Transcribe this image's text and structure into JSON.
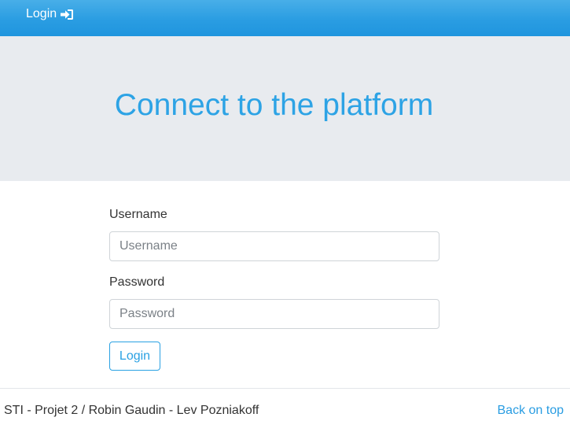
{
  "navbar": {
    "login_label": "Login",
    "login_icon": "sign-in-icon",
    "color": "#2a9de2"
  },
  "jumbotron": {
    "title": "Connect to the platform"
  },
  "form": {
    "username_label": "Username",
    "username_placeholder": "Username",
    "username_value": "",
    "password_label": "Password",
    "password_placeholder": "Password",
    "password_value": "",
    "submit_label": "Login"
  },
  "footer": {
    "credits": "STI - Projet 2 / Robin Gaudin - Lev Pozniakoff",
    "back_to_top": "Back on top"
  }
}
